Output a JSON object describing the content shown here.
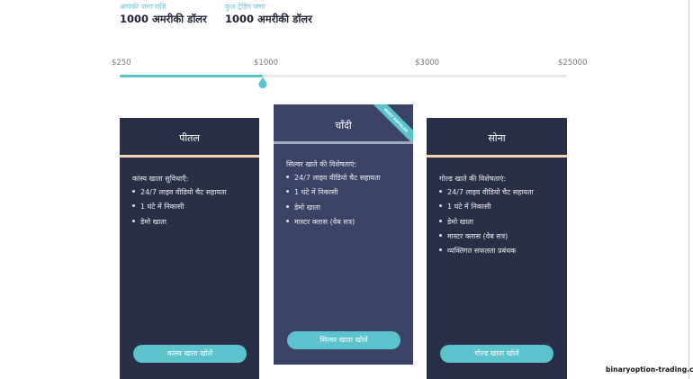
{
  "deposit": {
    "your_deposit_label": "आपकी जमा राशि",
    "your_deposit_value": "1000 अमरीकी डॉलर",
    "total_trading_label": "कुल ट्रेडिंग जमा",
    "total_trading_value": "1000 अमरीकी डॉलर"
  },
  "slider": {
    "ticks": [
      "$250",
      "$1000",
      "$3000",
      "$25000"
    ],
    "selected": "$1000",
    "fill_fraction": 0.32,
    "accent_color": "#57c3cb"
  },
  "cards": [
    {
      "title": "पीतल",
      "features_heading": "कांस्य खाता सुविधाएँ:",
      "features": [
        "24/7 लाइव वीडियो चैट सहायता",
        "1 घंटे में निकासी",
        "डेमो खाता"
      ],
      "button": "कांस्य खाता खोलें"
    },
    {
      "title": "चाँदी",
      "ribbon": "MOST POPULAR",
      "features_heading": "सिल्वर खाते की विशेषताएं:",
      "features": [
        "24/7 लाइव वीडियो चैट सहायता",
        "1 घंटे में निकासी",
        "डेमो खाता",
        "मास्टर क्लास (वेब सत्र)"
      ],
      "button": "सिल्वर खाता खोलें"
    },
    {
      "title": "सोना",
      "features_heading": "गोल्ड खाते की विशेषताएं:",
      "features": [
        "24/7 लाइव वीडियो चैट सहायता",
        "1 घंटे में निकासी",
        "डेमो खाता",
        "मास्टर क्लास (वेब सत्र)",
        "व्यक्तिगत सफलता प्रबंधक"
      ],
      "button": "गोल्ड खाता खोलें"
    }
  ],
  "colors": {
    "card_dark": "#2a2f48",
    "card_featured": "#3a4366",
    "button": "#5bc3cc",
    "bronze_separator": "#f6cfae",
    "silver_separator": "#a0a8be",
    "gold_separator": "#f3d3b4"
  },
  "watermark": "binaryoption-trading.com"
}
